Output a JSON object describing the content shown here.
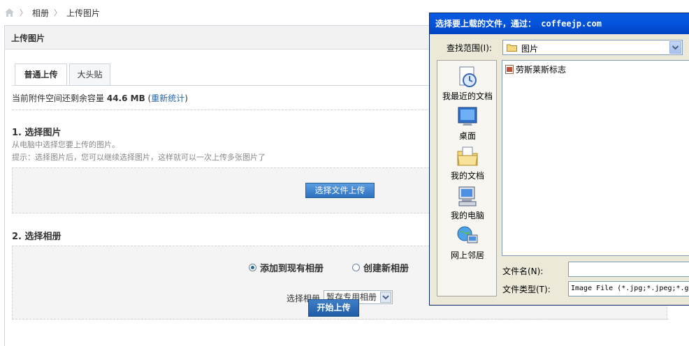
{
  "breadcrumb": {
    "items": [
      "相册",
      "上传图片"
    ]
  },
  "panel": {
    "title": "上传图片"
  },
  "tabs": [
    {
      "label": "普通上传",
      "active": true
    },
    {
      "label": "大头贴",
      "active": false
    }
  ],
  "quota": {
    "prefix": "当前附件空间还剩余容量",
    "value": "44.6 MB",
    "recount_link": "重新统计"
  },
  "step1": {
    "title": "1. 选择图片",
    "desc": "从电脑中选择您要上传的图片。",
    "tip": "提示：选择图片后，您可以继续选择图片，这样就可以一次上传多张图片了",
    "button": "选择文件上传"
  },
  "step2": {
    "title": "2. 选择相册",
    "option_existing": "添加到现有相册",
    "option_new": "创建新相册",
    "album_label": "选择相册",
    "album_selected": "暂存专用相册"
  },
  "start_button": "开始上传",
  "dialog": {
    "title": "选择要上载的文件，通过： coffeejp.com",
    "look_in_label": "查找范围(I):",
    "look_in_value": "图片",
    "places": [
      "我最近的文档",
      "桌面",
      "我的文档",
      "我的电脑",
      "网上邻居"
    ],
    "files": [
      "劳斯莱斯标志"
    ],
    "filename_label": "文件名(N):",
    "filename_value": "",
    "filetype_label": "文件类型(T):",
    "filetype_value": "Image File (*.jpg;*.jpeg;*.g"
  },
  "colors": {
    "link": "#2366a8",
    "title_bar": "#0453dc",
    "button_blue": "#2e72c0"
  }
}
